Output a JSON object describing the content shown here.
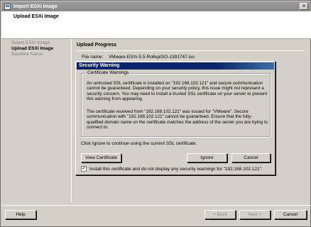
{
  "window": {
    "title": "Import ESXi Image",
    "close_glyph": "×"
  },
  "header": {
    "page_title": "Upload ESXi Image"
  },
  "steps": [
    {
      "label": "Select ESXi Image",
      "active": false
    },
    {
      "label": "Upload ESXi Image",
      "active": true
    },
    {
      "label": "Baseline Name",
      "active": false
    }
  ],
  "content": {
    "title": "Upload Progress",
    "file_label": "File name:",
    "file_value": "VMware-ESXi-5.5-RollupISO-1391747.iso"
  },
  "dialog": {
    "title": "Security Warning",
    "group_label": "Certificate Warnings",
    "paragraph1": "An untrusted SSL certificate is installed on \"192.168.102.121\" and secure communication cannot be guaranteed.  Depending on your security policy, this issue might not represent a security concern.  You may need to install a trusted SSL certificate on your server to prevent this warning from appearing.",
    "paragraph2": "The certificate received from \"192.168.102.121\" was issued for \"VMware\".  Secure communication with \"192.168.102.121\" cannot be guaranteed.  Ensure that the fully-qualified domain name on the certificate matches the address of the server you are trying to connect to.",
    "ignore_hint": "Click Ignore to continue using the current SSL certificate.",
    "view_certificate_label": "View Certificate",
    "ignore_label": "Ignore",
    "cancel_label": "Cancel",
    "checkbox_label": "Install this certificate and do not display any security warnings for \"192.168.102.121\".",
    "checkbox_checked": true,
    "checkbox_glyph": "✓"
  },
  "footer": {
    "help_label": "Help",
    "back_label": "< Back",
    "next_label": "Next >",
    "cancel_label": "Cancel"
  }
}
